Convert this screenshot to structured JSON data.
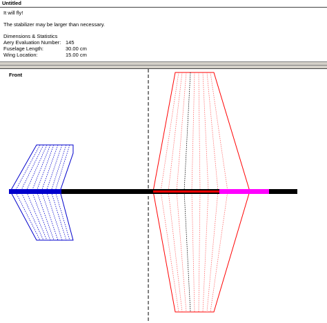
{
  "window": {
    "title": "Untitled"
  },
  "info": {
    "status": "It will fly!",
    "warning": "The stabilizer may be larger than necessary.",
    "section_title": "Dimensions & Statistics",
    "stats": [
      {
        "label": "Aery Evaluation Number:",
        "value": "145"
      },
      {
        "label": "Fuselage Length:",
        "value": "30.00 cm"
      },
      {
        "label": "Wing Location:",
        "value": "15.00 cm"
      }
    ]
  },
  "view": {
    "label": "Front"
  },
  "colors": {
    "stabilizer": "#0000cc",
    "wing": "#ff0000",
    "fuselage": "#000000",
    "wing_marker": "#ff00ff",
    "fold_lines_wing": "#ff6666",
    "fold_lines_stab": "#0000cc",
    "center_line": "#000000"
  }
}
